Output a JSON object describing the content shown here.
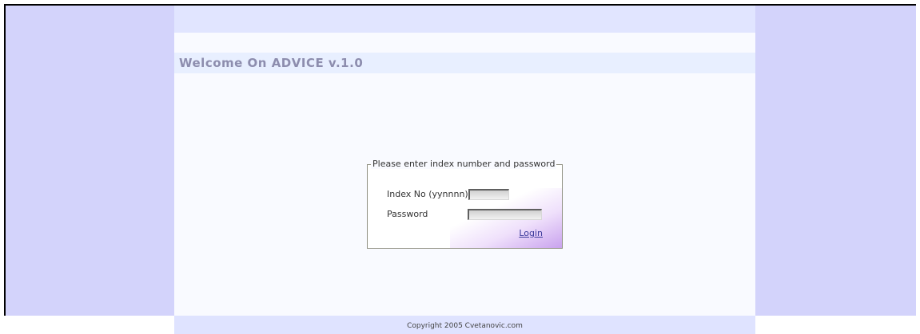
{
  "header": {
    "title": "Welcome On ADVICE v.1.0"
  },
  "login": {
    "legend": "Please enter index number and password",
    "index_label": "Index No (yynnnn)",
    "index_value": "",
    "password_label": "Password",
    "password_value": "",
    "login_label": "Login"
  },
  "footer": {
    "copyright": "Copyright 2005 Cvetanovic.com"
  },
  "colors": {
    "side_panel": "#d3d3fb",
    "content_bg": "#f9faff",
    "title_bar": "#e8efff",
    "title_text": "#8d8dae",
    "footer_bg": "#dfe3ff"
  }
}
